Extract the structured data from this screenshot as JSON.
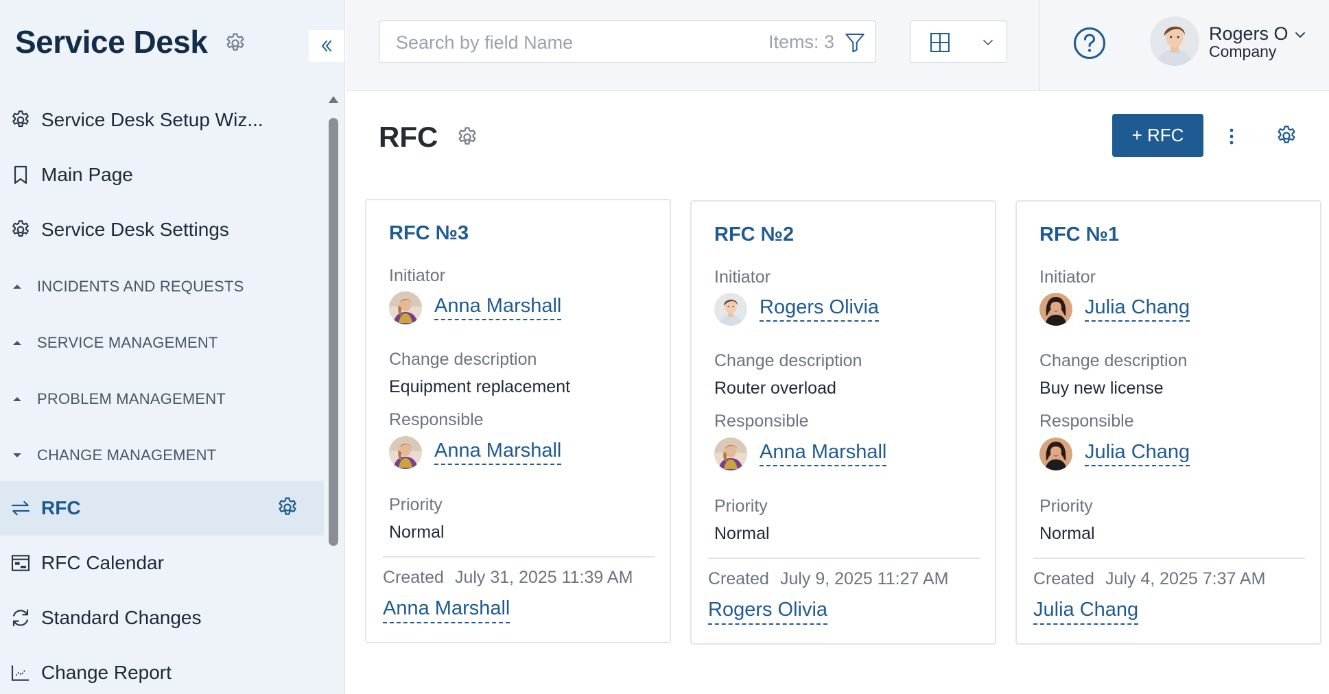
{
  "sidebar": {
    "title": "Service Desk",
    "items_top": [
      {
        "label": "Service Desk Setup Wiz...",
        "icon": "gear-icon"
      },
      {
        "label": "Main Page",
        "icon": "bookmark-icon"
      },
      {
        "label": "Service Desk Settings",
        "icon": "gear-icon"
      }
    ],
    "sections": [
      {
        "label": "INCIDENTS AND REQUESTS",
        "state": "collapsed"
      },
      {
        "label": "SERVICE MANAGEMENT",
        "state": "collapsed"
      },
      {
        "label": "PROBLEM MANAGEMENT",
        "state": "collapsed"
      },
      {
        "label": "CHANGE MANAGEMENT",
        "state": "expanded"
      }
    ],
    "change_items": [
      {
        "label": "RFC",
        "icon": "arrows-exchange-icon",
        "active": true
      },
      {
        "label": "RFC Calendar",
        "icon": "calendar-board-icon"
      },
      {
        "label": "Standard Changes",
        "icon": "refresh-icon"
      },
      {
        "label": "Change Report",
        "icon": "chart-icon"
      }
    ]
  },
  "topbar": {
    "search_placeholder": "Search by field Name",
    "items_count": "Items: 3",
    "user_name": "Rogers O",
    "user_company": "Company"
  },
  "main": {
    "title": "RFC",
    "add_button": "+ RFC"
  },
  "labels": {
    "initiator": "Initiator",
    "change_description": "Change description",
    "responsible": "Responsible",
    "priority": "Priority",
    "created": "Created"
  },
  "cards": [
    {
      "title": "RFC №3",
      "initiator": "Anna Marshall",
      "description": "Equipment replacement",
      "responsible": "Anna Marshall",
      "priority": "Normal",
      "created": "July 31, 2025 11:39 AM",
      "author": "Anna Marshall"
    },
    {
      "title": "RFC №2",
      "initiator": "Rogers Olivia",
      "description": "Router overload",
      "responsible": "Anna Marshall",
      "priority": "Normal",
      "created": "July 9, 2025 11:27 AM",
      "author": "Rogers Olivia"
    },
    {
      "title": "RFC №1",
      "initiator": "Julia Chang",
      "description": "Buy new license",
      "responsible": "Julia Chang",
      "priority": "Normal",
      "created": "July 4, 2025 7:37 AM",
      "author": "Julia Chang"
    }
  ],
  "colors": {
    "accent": "#1e5b92",
    "sidebar_bg": "#eef3f9",
    "active_item_bg": "#dde8f3",
    "title_dark": "#132c48"
  }
}
